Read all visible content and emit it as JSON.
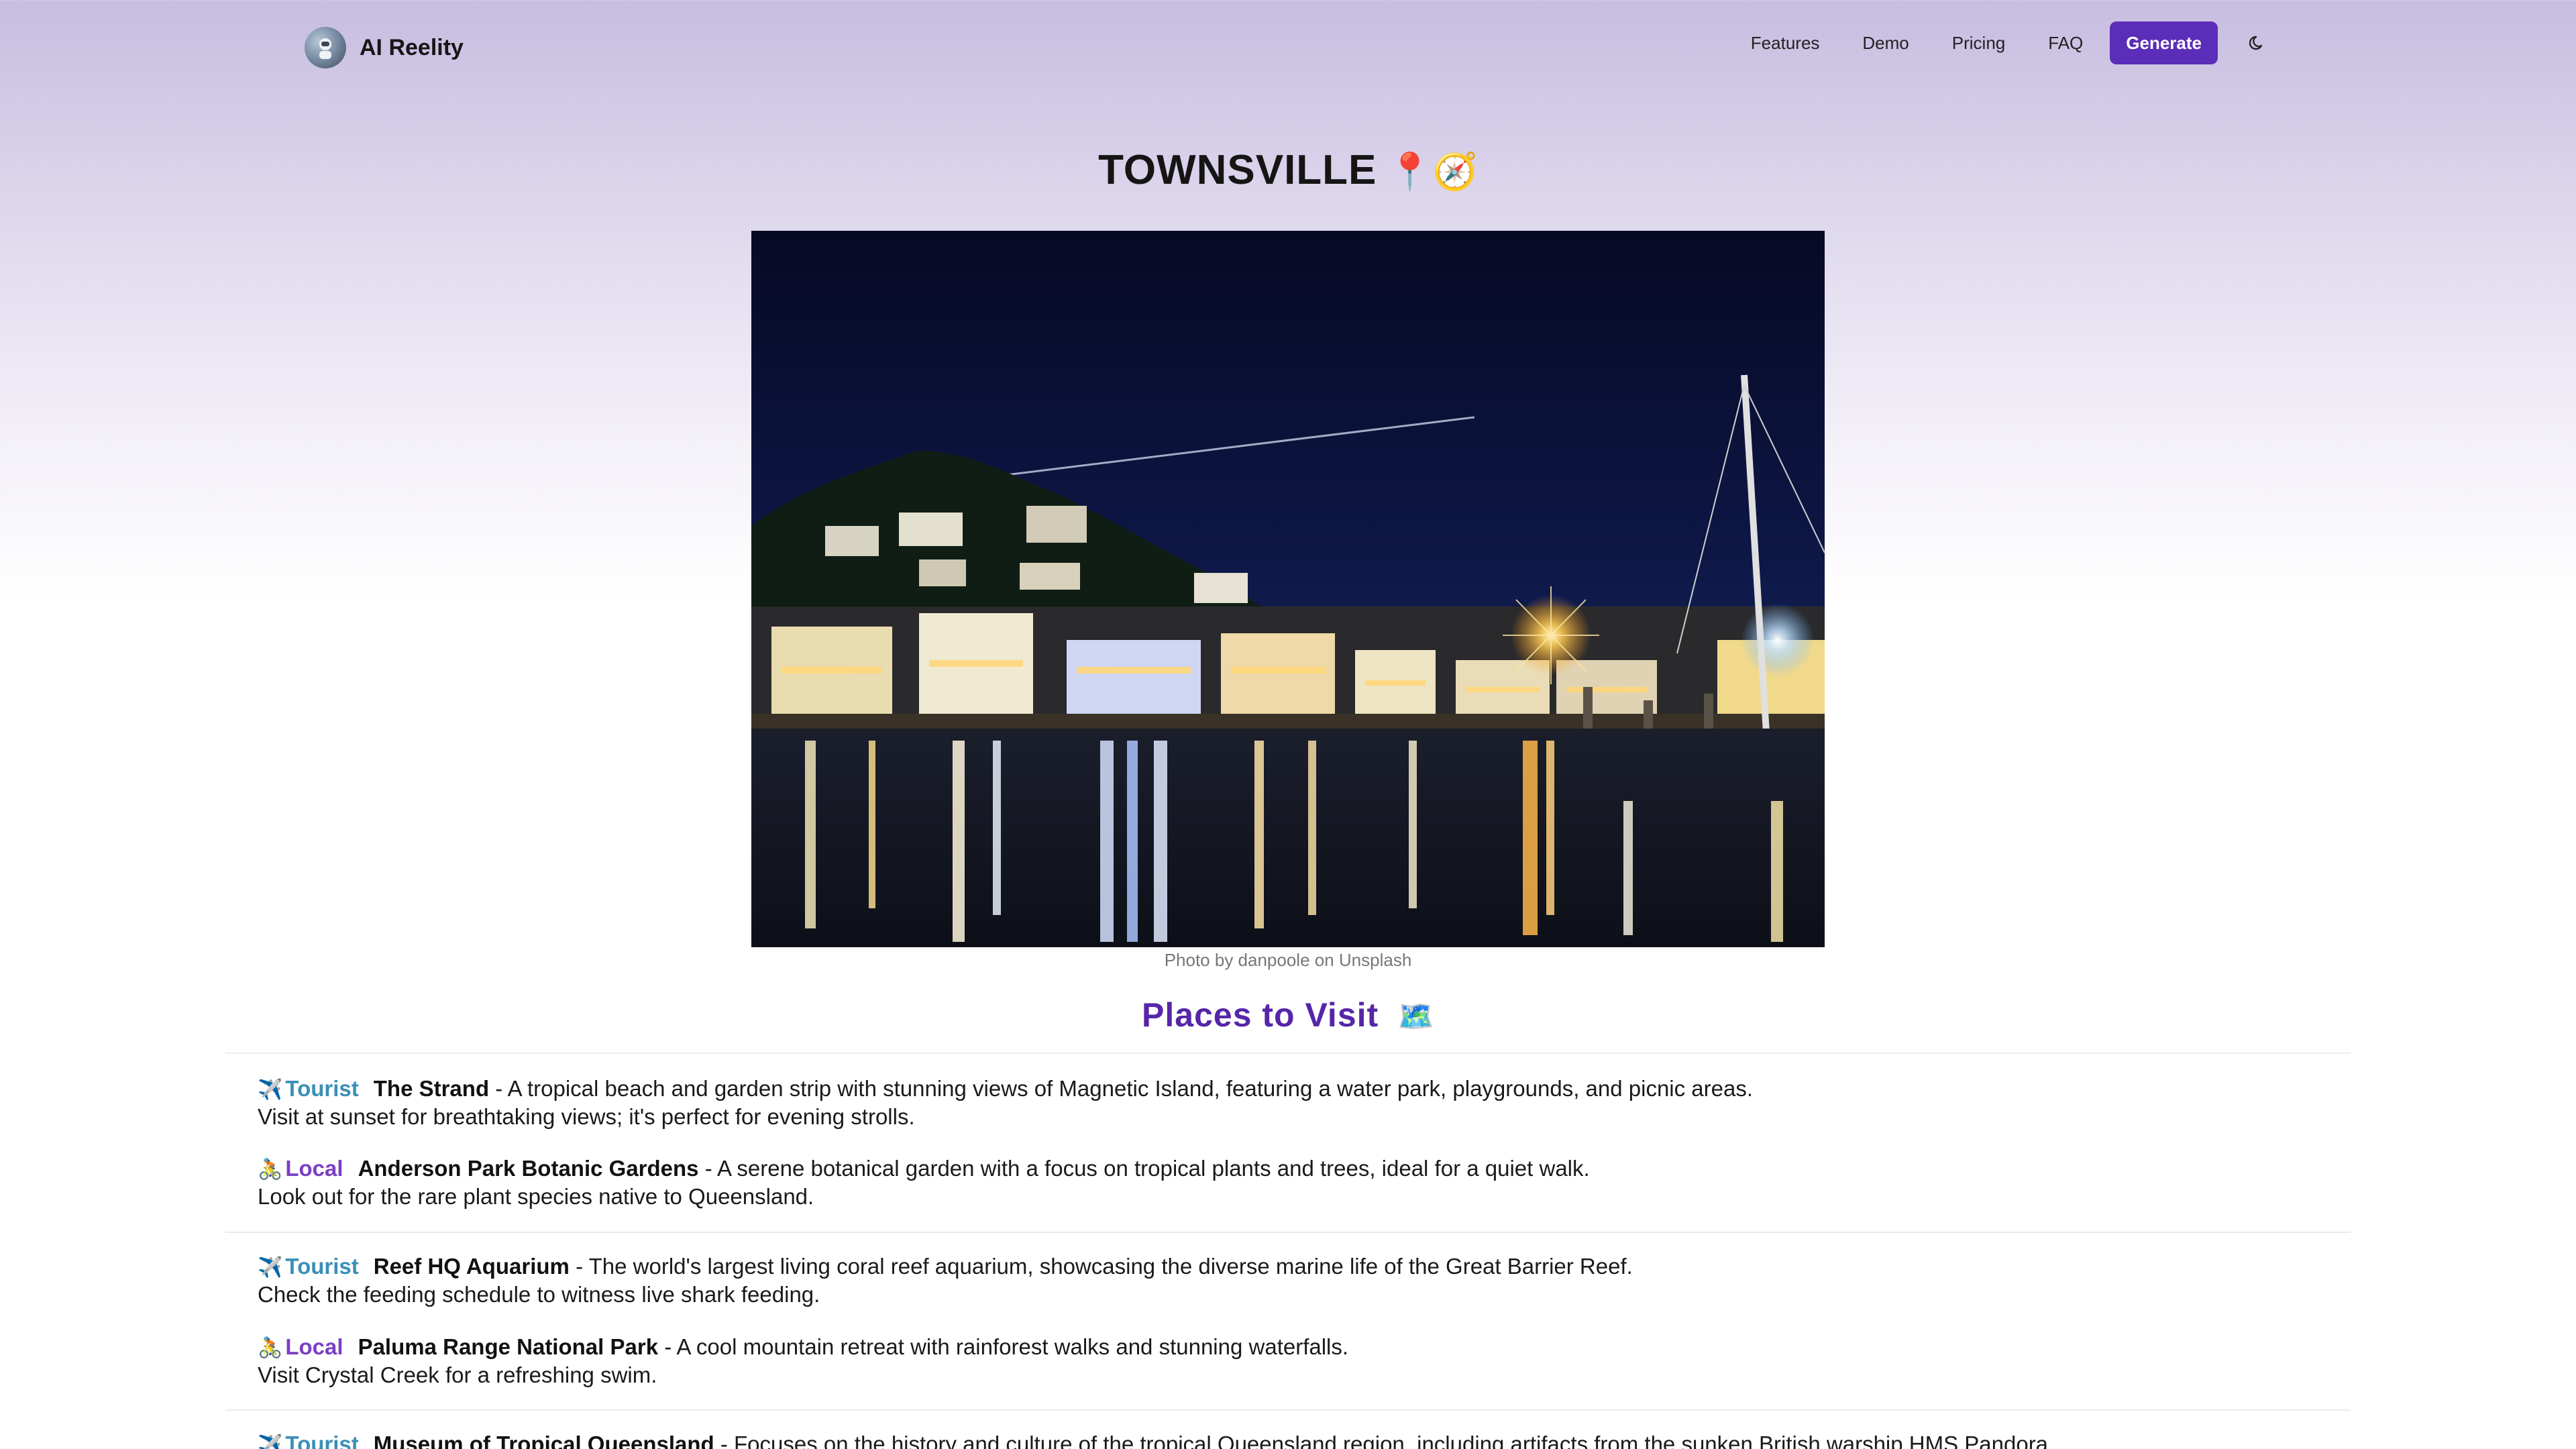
{
  "header": {
    "brand_name": "AI Reelity",
    "brand_icon": "astronaut-icon",
    "nav": [
      "Features",
      "Demo",
      "Pricing",
      "FAQ"
    ],
    "generate_label": "Generate",
    "theme_icon": "moon-icon"
  },
  "page": {
    "title": "TOWNSVILLE",
    "title_emoji": "📍🧭",
    "photo_credit": "Photo by danpoole on Unsplash",
    "section_title": "Places to Visit",
    "section_emoji": "🗺️"
  },
  "places": [
    {
      "type_icon": "✈️",
      "type": "Tourist",
      "name": "The Strand",
      "description": " - A tropical beach and garden strip with stunning views of Magnetic Island, featuring a water park, playgrounds, and picnic areas.",
      "tip": "Visit at sunset for breathtaking views; it's perfect for evening strolls."
    },
    {
      "type_icon": "🚴",
      "type": "Local",
      "name": "Anderson Park Botanic Gardens",
      "description": " - A serene botanical garden with a focus on tropical plants and trees, ideal for a quiet walk.",
      "tip": "Look out for the rare plant species native to Queensland."
    },
    {
      "type_icon": "✈️",
      "type": "Tourist",
      "name": "Reef HQ Aquarium",
      "description": " - The world's largest living coral reef aquarium, showcasing the diverse marine life of the Great Barrier Reef.",
      "tip": "Check the feeding schedule to witness live shark feeding."
    },
    {
      "type_icon": "🚴",
      "type": "Local",
      "name": "Paluma Range National Park",
      "description": " - A cool mountain retreat with rainforest walks and stunning waterfalls.",
      "tip": "Visit Crystal Creek for a refreshing swim."
    },
    {
      "type_icon": "✈️",
      "type": "Tourist",
      "name": "Museum of Tropical Queensland",
      "description": " - Focuses on the history and culture of the tropical Queensland region, including artifacts from the sunken British warship HMS Pandora.",
      "tip": ""
    }
  ],
  "colors": {
    "accent": "#5b2db8",
    "tourist": "#3a8fb7",
    "local": "#7b3fc4"
  }
}
